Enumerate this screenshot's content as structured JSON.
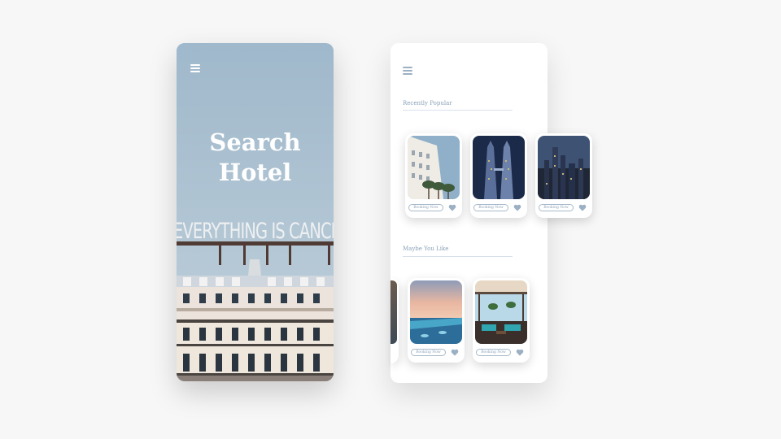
{
  "screen_one": {
    "title": "Search\nHotel",
    "sign_text": "EVERYTHING IS CANCELED"
  },
  "screen_two": {
    "sections": [
      {
        "title": "Recently Popular",
        "cards": [
          {
            "button": "Booking Now",
            "icon": "heart-icon"
          },
          {
            "button": "Booking Now",
            "icon": "heart-icon"
          },
          {
            "button": "Booking Now",
            "icon": "heart-icon"
          }
        ]
      },
      {
        "title": "Maybe You Like",
        "cards": [
          {
            "button": "Booking Now",
            "icon": "heart-icon"
          },
          {
            "button": "Booking Now",
            "icon": "heart-icon"
          }
        ]
      }
    ]
  },
  "colors": {
    "accent": "#9cb0c4",
    "background": "#f7f7f7",
    "sky": "#a4bccd"
  }
}
